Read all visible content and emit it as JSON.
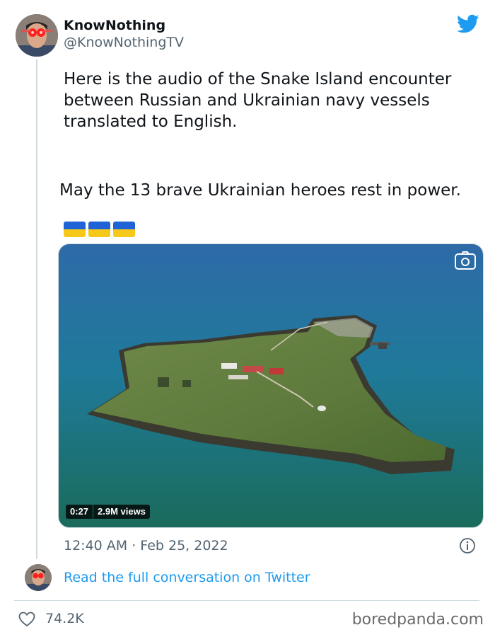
{
  "author": {
    "display_name": "KnowNothing",
    "handle": "@KnowNothingTV"
  },
  "tweet": {
    "text_line1": "Here is the audio of the Snake Island encounter between Russian and Ukrainian navy vessels translated to English.",
    "text_line2": "May the 13 brave Ukrainian heroes rest in power.",
    "flags": [
      "ukraine-flag",
      "ukraine-flag",
      "ukraine-flag"
    ],
    "timestamp": "12:40 AM · Feb 25, 2022"
  },
  "media": {
    "type": "video",
    "duration": "0:27",
    "views": "2.9M views"
  },
  "conversation": {
    "link_text": "Read the full conversation on Twitter"
  },
  "engagement": {
    "likes": "74.2K"
  },
  "watermark": "boredpanda.com",
  "colors": {
    "twitter_blue": "#1d9bf0",
    "secondary_text": "#536471",
    "flag_blue": "#1f63d6",
    "flag_yellow": "#f6c81a"
  },
  "icons": [
    "twitter-logo-icon",
    "camera-icon",
    "info-icon",
    "heart-icon"
  ]
}
